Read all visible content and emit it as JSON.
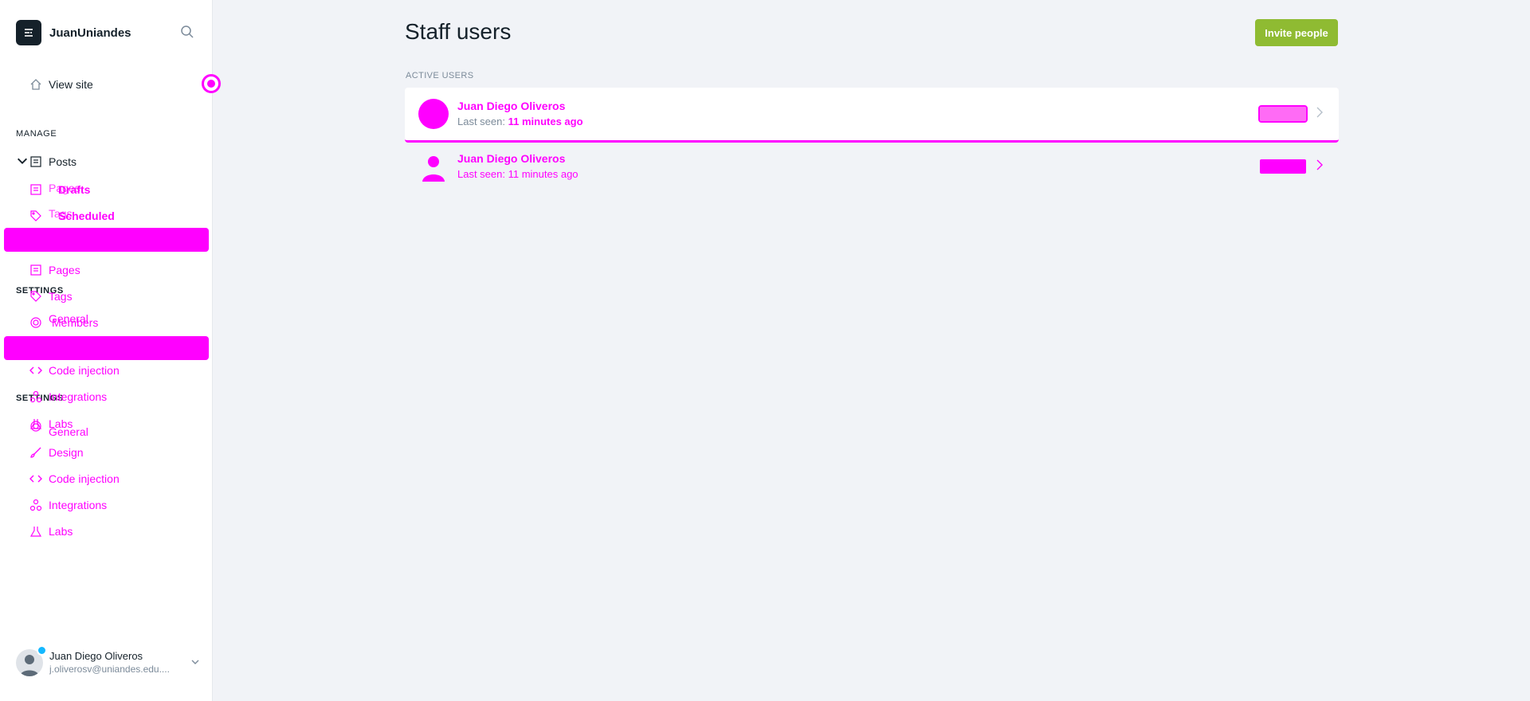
{
  "brand": {
    "name": "JuanUniandes"
  },
  "sidebar": {
    "view_site": "View site",
    "manage_label": "MANAGE",
    "posts": "Posts",
    "posts_sub": [
      "Drafts",
      "Scheduled"
    ],
    "ghost_items": [
      "Pages",
      "Tags"
    ],
    "items": [
      {
        "label": "Pages",
        "icon": "pages-icon"
      },
      {
        "label": "Tags",
        "icon": "tag-icon"
      },
      {
        "label": "Members",
        "icon": "members-icon"
      },
      {
        "label": "Code injection",
        "icon": "code-icon"
      },
      {
        "label": "Integrations",
        "icon": "integrations-icon"
      },
      {
        "label": "Labs",
        "icon": "labs-icon"
      }
    ],
    "settings_label": "SETTINGS",
    "settings_ghost": "General",
    "settings_items": [
      {
        "label": "General",
        "icon": "gear-icon"
      },
      {
        "label": "Design",
        "icon": "brush-icon"
      },
      {
        "label": "Code injection",
        "icon": "code-icon"
      },
      {
        "label": "Integrations",
        "icon": "integrations-icon"
      },
      {
        "label": "Labs",
        "icon": "labs-icon"
      }
    ]
  },
  "account": {
    "name": "Juan Diego Oliveros",
    "email": "j.oliverosv@uniandes.edu...."
  },
  "main": {
    "title": "Staff users",
    "invite_label": "Invite people",
    "active_label": "ACTIVE USERS",
    "users": [
      {
        "name": "Juan Diego Oliveros",
        "seen_prefix": "Last seen: ",
        "seen_value": "11 minutes ago"
      },
      {
        "name": "Juan Diego Oliveros",
        "seen_prefix": "Last seen: ",
        "seen_value": "11 minutes ago"
      }
    ]
  },
  "colors": {
    "accent": "#8fbb32",
    "highlight": "#ff00ff",
    "text": "#15212a"
  }
}
